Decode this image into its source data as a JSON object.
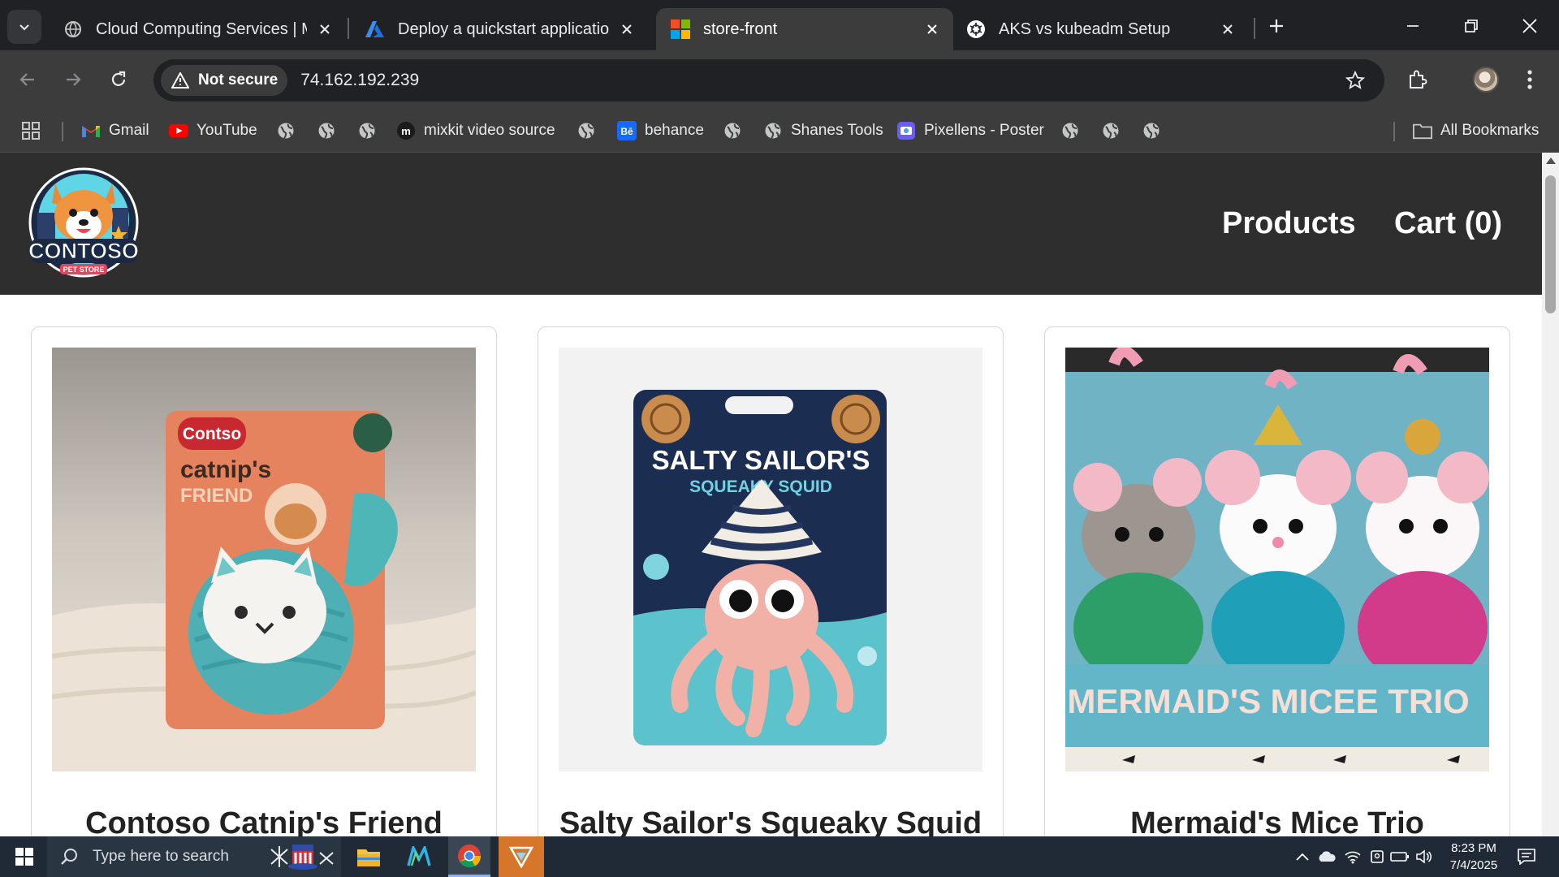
{
  "browser": {
    "tabs": [
      {
        "title": "Cloud Computing Services | Mic",
        "icon": "globe-icon",
        "active": false
      },
      {
        "title": "Deploy a quickstart application",
        "icon": "azure-icon",
        "active": false
      },
      {
        "title": "store-front",
        "icon": "microsoft-icon",
        "active": true
      },
      {
        "title": "AKS vs kubeadm Setup",
        "icon": "openai-icon",
        "active": false
      }
    ],
    "security_label": "Not secure",
    "url": "74.162.192.239",
    "bookmarks": [
      {
        "label": "Gmail",
        "icon": "gmail-icon"
      },
      {
        "label": "YouTube",
        "icon": "youtube-icon"
      },
      {
        "label": "mixkit video source",
        "icon": "mixkit-icon"
      },
      {
        "label": "behance",
        "icon": "behance-icon"
      },
      {
        "label": "Shanes Tools",
        "icon": "globe-icon"
      },
      {
        "label": "Pixellens - Poster",
        "icon": "pixellens-icon"
      }
    ],
    "all_bookmarks_label": "All Bookmarks"
  },
  "site": {
    "logo_text": "CONTOSO",
    "logo_subtext": "PET STORE",
    "nav": {
      "products": "Products",
      "cart": "Cart (0)"
    },
    "products": [
      {
        "name": "Contoso Catnip's Friend",
        "box_brand": "Contso",
        "box_title": "catnip's",
        "box_subtitle": "FRIEND"
      },
      {
        "name": "Salty Sailor's Squeaky Squid",
        "box_title": "SALTY SAILOR'S",
        "box_subtitle": "SQUEAKY SQUID"
      },
      {
        "name": "Mermaid's Mice Trio",
        "box_title": "MERMAID'S MICEE TRIO"
      }
    ]
  },
  "taskbar": {
    "search_placeholder": "Type here to search",
    "time": "8:23 PM",
    "date": "7/4/2025"
  },
  "colors": {
    "browser_dark": "#202124",
    "toolbar": "#3c3c3c",
    "site_header": "#2e2e2e",
    "taskbar": "#1f2a36"
  }
}
